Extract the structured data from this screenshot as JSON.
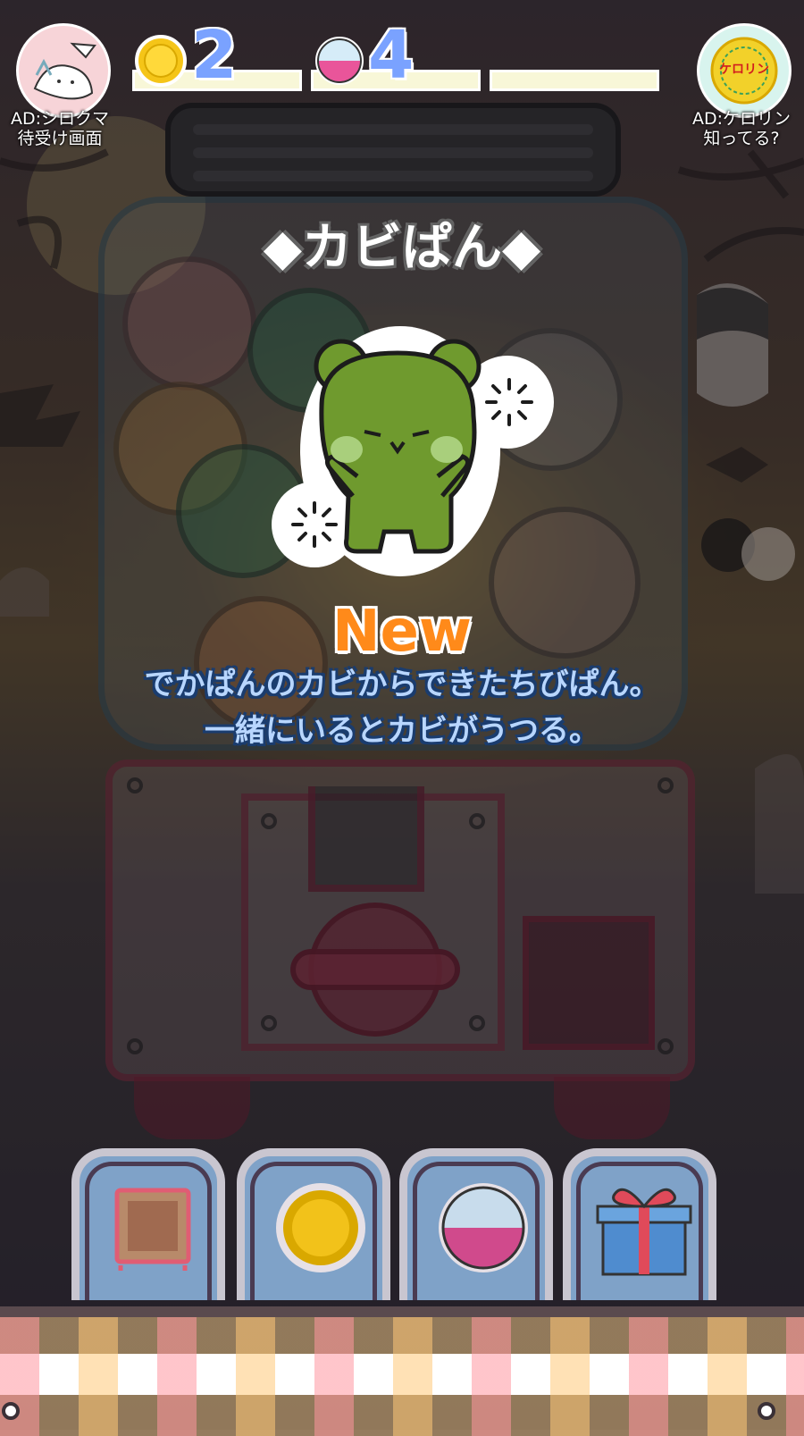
{
  "top_bar": {
    "ad_left_label_1": "AD:シロクマ",
    "ad_left_label_2": "待受け画面",
    "ad_right_label_1": "AD:ケロリン",
    "ad_right_label_2": "知ってる?",
    "ad_right_logo_text": "ケロリン",
    "coin_count": "2",
    "capsule_count": "4"
  },
  "popup": {
    "title": "◆カビぱん◆",
    "new_badge": "New",
    "description_line_1": "でかぱんのカビからできたちびぱん。",
    "description_line_2": "一緒にいるとカビがうつる。"
  },
  "bottom_menu": [
    {
      "name": "collection",
      "icon": "frame-icon"
    },
    {
      "name": "coin",
      "icon": "coin-icon"
    },
    {
      "name": "capsule",
      "icon": "capsule-icon"
    },
    {
      "name": "gift",
      "icon": "gift-icon"
    }
  ],
  "colors": {
    "count_text": "#7aa2ff",
    "new_badge": "#ff8a1a",
    "description_text": "#b8d6ff",
    "bear_green": "#6f9a2e"
  }
}
